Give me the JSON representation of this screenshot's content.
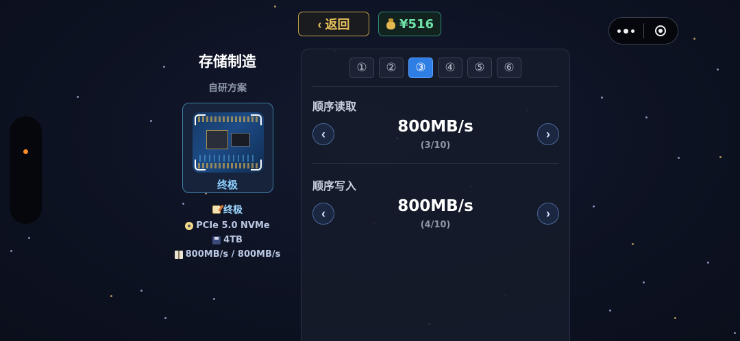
{
  "top_bar": {
    "back_label": "‹ 返回",
    "money": "¥516",
    "money_icon": "money-bag-icon"
  },
  "product": {
    "title": "存储制造",
    "subtitle": "自研方案",
    "card_label": "终极",
    "specs": [
      {
        "icon": "memo-icon",
        "text": "终极"
      },
      {
        "icon": "disc-icon",
        "text": "PCIe 5.0 NVMe"
      },
      {
        "icon": "floppy-disk-icon",
        "text": "4TB"
      },
      {
        "icon": "book-icon",
        "text": "800MB/s / 800MB/s"
      }
    ]
  },
  "tabs": [
    {
      "label": "①",
      "active": false
    },
    {
      "label": "②",
      "active": false
    },
    {
      "label": "③",
      "active": true
    },
    {
      "label": "④",
      "active": false
    },
    {
      "label": "⑤",
      "active": false
    },
    {
      "label": "⑥",
      "active": false
    }
  ],
  "settings": [
    {
      "label": "顺序读取",
      "value": "800MB/s",
      "level": "(3/10)",
      "prev": "‹",
      "next": "›"
    },
    {
      "label": "顺序写入",
      "value": "800MB/s",
      "level": "(4/10)",
      "prev": "‹",
      "next": "›"
    }
  ],
  "colors": {
    "accent_blue": "#2f7ee6",
    "gold": "#e7c15a",
    "money_green": "#6fe3a8",
    "indicator_orange": "#ff8a2a"
  }
}
